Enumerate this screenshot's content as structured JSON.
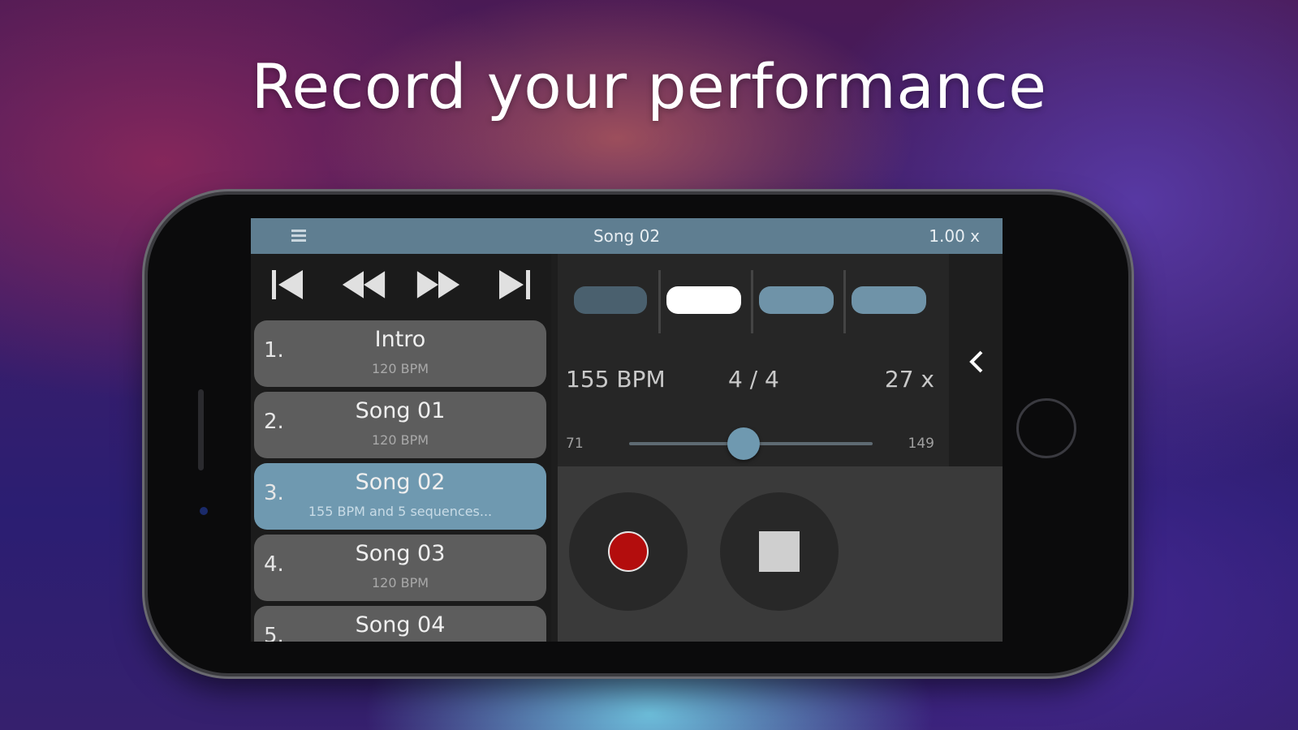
{
  "headline": "Record your performance",
  "app": {
    "title": "Song 02",
    "speed": "1.00 x",
    "songs": [
      {
        "number": "1.",
        "name": "Intro",
        "subtitle": "120 BPM",
        "active": false
      },
      {
        "number": "2.",
        "name": "Song 01",
        "subtitle": "120 BPM",
        "active": false
      },
      {
        "number": "3.",
        "name": "Song 02",
        "subtitle": "155 BPM and 5 sequences...",
        "active": true
      },
      {
        "number": "4.",
        "name": "Song 03",
        "subtitle": "120 BPM",
        "active": false
      },
      {
        "number": "5.",
        "name": "Song 04",
        "subtitle": "",
        "active": false
      }
    ],
    "tempo": {
      "bpm": "155 BPM",
      "time_signature": "4 / 4",
      "repeat": "27 x",
      "min": "71",
      "max": "149",
      "slider_fraction": 0.47
    },
    "sequences": [
      {
        "state": "dim",
        "color": "#4a606e"
      },
      {
        "state": "selected",
        "color": "#ffffff"
      },
      {
        "state": "normal",
        "color": "#6f93a8"
      },
      {
        "state": "normal",
        "color": "#6f93a8"
      }
    ],
    "icons": {
      "menu": "menu-icon",
      "skip_back": "skip-to-start-icon",
      "rewind": "rewind-icon",
      "fast_forward": "fast-forward-icon",
      "skip_forward": "skip-to-end-icon",
      "collapse": "chevron-left-icon",
      "record": "record-icon",
      "stop": "stop-icon"
    },
    "colors": {
      "titlebar": "#5f7e91",
      "active_song": "#6f99b0",
      "record": "#b30d0d"
    }
  }
}
